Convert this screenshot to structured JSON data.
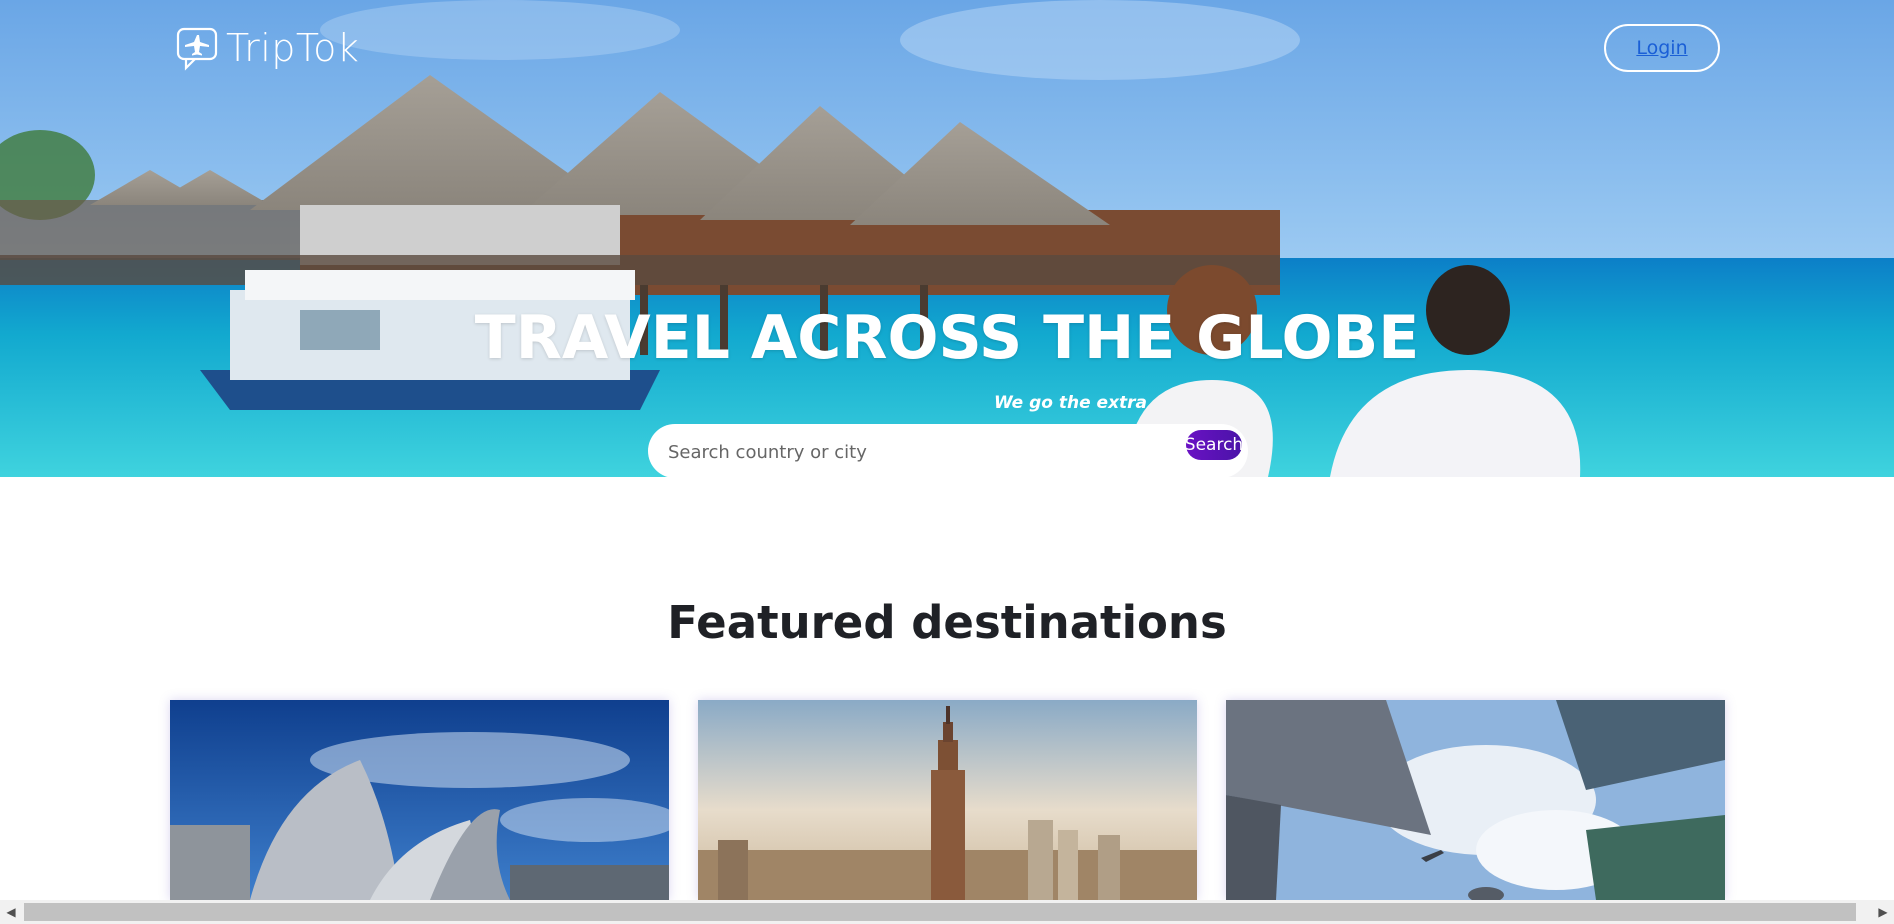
{
  "header": {
    "logo_text": "TripTok",
    "logo_icon": "airplane-chat-bubble-icon",
    "login_label": "Login"
  },
  "hero": {
    "title": "TRAVEL ACROSS THE GLOBE",
    "subtitle": "We go the extra",
    "search": {
      "placeholder": "Search country or city",
      "value": "",
      "button_label": "Search"
    }
  },
  "featured": {
    "title": "Featured destinations",
    "cards": [
      {
        "image": "modern-steel-concert-hall-blue-sky"
      },
      {
        "image": "empire-state-building-city-skyline"
      },
      {
        "image": "skyscrapers-looking-up-airplane"
      }
    ]
  },
  "colors": {
    "accent": "#6a12c4",
    "login_text": "#1a5fd6",
    "sea": "#2fc7d8",
    "sky": "#7fb2e8"
  }
}
